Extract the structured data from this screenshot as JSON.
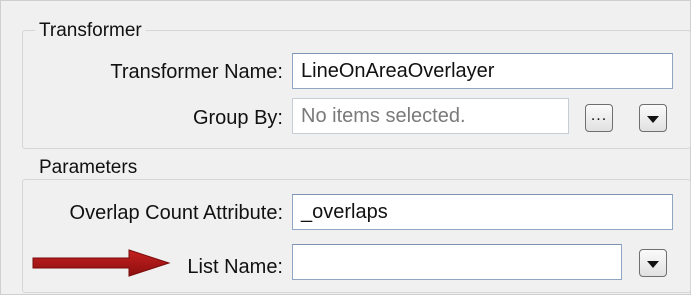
{
  "transformer_section": {
    "title": "Transformer",
    "name_label": "Transformer Name:",
    "name_value": "LineOnAreaOverlayer",
    "group_by_label": "Group By:",
    "group_by_placeholder": "No items selected.",
    "ellipsis_button": "..."
  },
  "parameters_section": {
    "title": "Parameters",
    "overlap_label": "Overlap Count Attribute:",
    "overlap_value": "_overlaps",
    "list_name_label": "List Name:",
    "list_name_value": ""
  },
  "icons": {
    "dropdown": "chevron-down-icon",
    "annotation_arrow": "red-arrow-icon"
  },
  "colors": {
    "annotation_arrow": "#b01515"
  }
}
